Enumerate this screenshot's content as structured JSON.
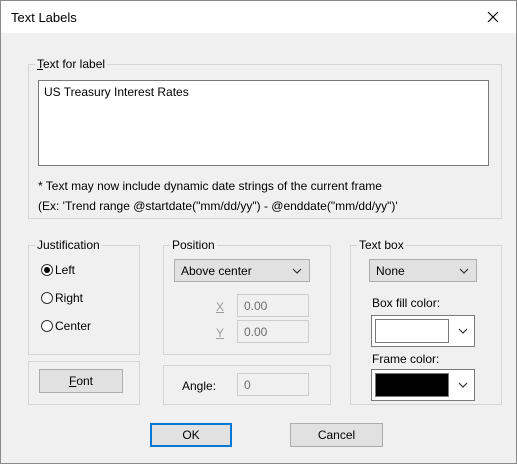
{
  "window": {
    "title": "Text Labels"
  },
  "text_group": {
    "legend_accel": "T",
    "legend_rest": "ext for label",
    "value": "US Treasury Interest Rates",
    "note_line1": "* Text may now include dynamic date strings of the current frame",
    "note_line2": "(Ex: 'Trend range @startdate(\"mm/dd/yy\") - @enddate(\"mm/dd/yy\")'"
  },
  "justification": {
    "legend": "Justification",
    "options": [
      "Left",
      "Right",
      "Center"
    ],
    "selected": "Left"
  },
  "position": {
    "legend": "Position",
    "selected": "Above center",
    "x_label": "X",
    "x_value": "0.00",
    "y_label": "Y",
    "y_value": "0.00"
  },
  "textbox": {
    "legend": "Text box",
    "selected": "None",
    "fill_label": "Box fill color:",
    "fill_color": "#ffffff",
    "frame_label": "Frame color:",
    "frame_color": "#000000"
  },
  "font_button": {
    "accel": "F",
    "rest": "ont"
  },
  "angle": {
    "label": "Angle:",
    "value": "0"
  },
  "buttons": {
    "ok": "OK",
    "cancel": "Cancel"
  },
  "icons": {
    "close": "close-icon",
    "dropdown": "chevron-down-icon"
  }
}
